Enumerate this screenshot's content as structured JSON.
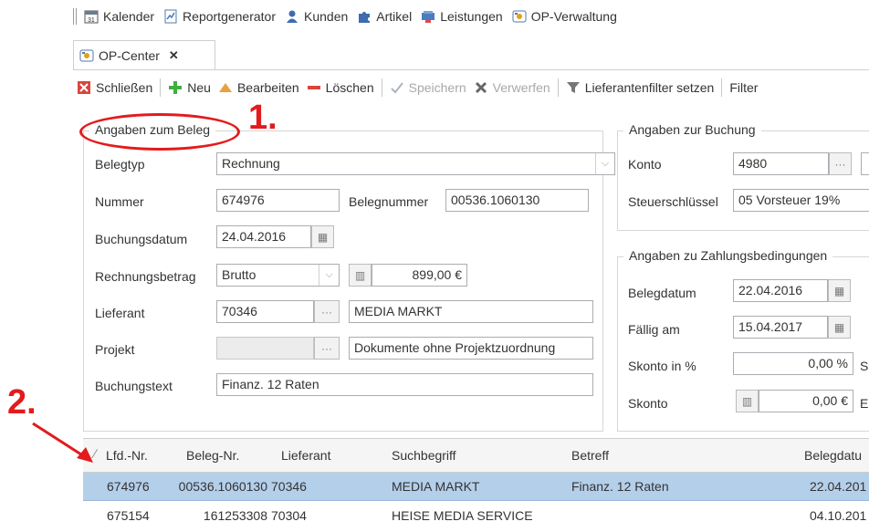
{
  "nav": {
    "items": [
      {
        "label": "Kalender",
        "icon": "calendar-icon"
      },
      {
        "label": "Reportgenerator",
        "icon": "report-icon"
      },
      {
        "label": "Kunden",
        "icon": "customers-icon"
      },
      {
        "label": "Artikel",
        "icon": "articles-icon"
      },
      {
        "label": "Leistungen",
        "icon": "services-icon"
      },
      {
        "label": "OP-Verwaltung",
        "icon": "op-icon"
      }
    ]
  },
  "tab": {
    "label": "OP-Center",
    "close": "✕"
  },
  "toolbar": {
    "close": "Schließen",
    "new": "Neu",
    "edit": "Bearbeiten",
    "delete": "Löschen",
    "save": "Speichern",
    "discard": "Verwerfen",
    "supplier_filter": "Lieferantenfilter setzen",
    "filter": "Filter"
  },
  "beleg": {
    "title": "Angaben zum Beleg",
    "typ_label": "Belegtyp",
    "typ_value": "Rechnung",
    "nummer_label": "Nummer",
    "nummer_value": "674976",
    "belegnummer_label": "Belegnummer",
    "belegnummer_value": "00536.1060130",
    "buchungsdatum_label": "Buchungsdatum",
    "buchungsdatum_value": "24.04.2016",
    "betrag_label": "Rechnungsbetrag",
    "betrag_type": "Brutto",
    "betrag_value": "899,00 €",
    "lieferant_label": "Lieferant",
    "lieferant_nr": "70346",
    "lieferant_name": "MEDIA MARKT",
    "projekt_label": "Projekt",
    "projekt_value": "",
    "projekt_name": "Dokumente ohne Projektzuordnung",
    "buchungstext_label": "Buchungstext",
    "buchungstext_value": "Finanz. 12 Raten"
  },
  "buchung": {
    "title": "Angaben zur Buchung",
    "konto_label": "Konto",
    "konto_value": "4980",
    "steuer_label": "Steuerschlüssel",
    "steuer_value": "05 Vorsteuer 19%"
  },
  "zahlung": {
    "title": "Angaben zu Zahlungsbedingungen",
    "belegdatum_label": "Belegdatum",
    "belegdatum_value": "22.04.2016",
    "faellig_label": "Fällig am",
    "faellig_value": "15.04.2017",
    "skonto_pct_label": "Skonto in %",
    "skonto_pct_value": "0,00 %",
    "skonto_pct_suffix": "S",
    "skonto_label": "Skonto",
    "skonto_value": "0,00 €",
    "skonto_suffix": "E"
  },
  "annotations": {
    "one": "1.",
    "two": "2."
  },
  "table": {
    "columns": [
      "Lfd.-Nr.",
      "Beleg-Nr.",
      "Lieferant",
      "Suchbegriff",
      "Betreff",
      "Belegdatu"
    ],
    "rows": [
      [
        "674976",
        "00536.1060130",
        "70346",
        "MEDIA MARKT",
        "Finanz. 12 Raten",
        "22.04.201"
      ],
      [
        "675154",
        "161253308",
        "70304",
        "HEISE MEDIA SERVICE",
        "",
        "04.10.201"
      ]
    ]
  },
  "colors": {
    "accent": "#3d7cc9",
    "selected_row": "#b4cfea",
    "annotation_red": "#e31b1b"
  }
}
